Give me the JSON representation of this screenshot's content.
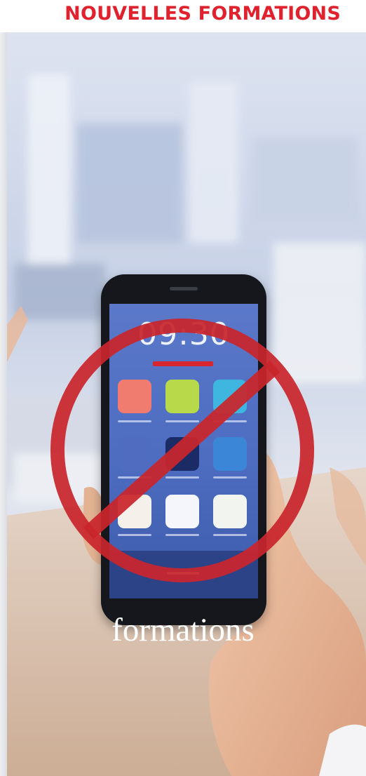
{
  "header": {
    "title": "NOUVELLES FORMATIONS",
    "title_color": "#e0222e"
  },
  "phone": {
    "time": "09:30"
  },
  "overlay": {
    "symbol": "prohibition-sign",
    "color": "#c9262c"
  },
  "caption": {
    "text": "formations"
  }
}
